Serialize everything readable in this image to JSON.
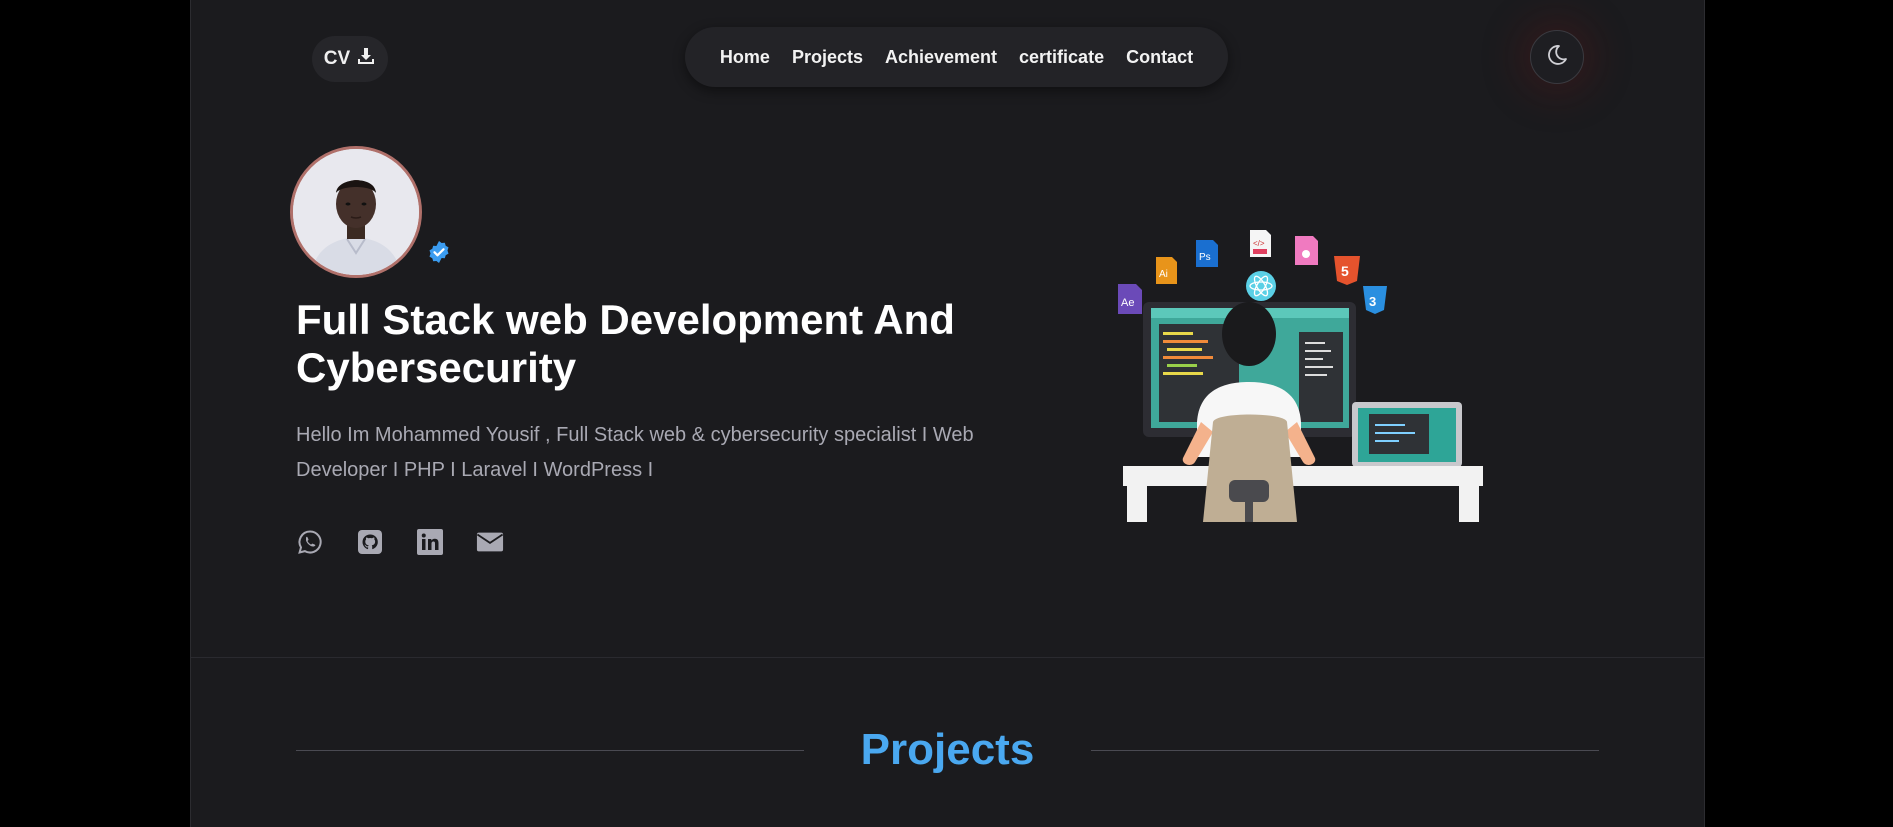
{
  "header": {
    "cv_label": "CV",
    "nav": [
      {
        "label": "Home"
      },
      {
        "label": "Projects"
      },
      {
        "label": "Achievement"
      },
      {
        "label": "certificate"
      },
      {
        "label": "Contact"
      }
    ],
    "theme_icon": "moon-icon"
  },
  "hero": {
    "title": "Full Stack web Development And Cybersecurity",
    "description": "Hello Im Mohammed Yousif , Full Stack web & cybersecurity specialist I Web Developer I PHP I Laravel I WordPress I",
    "verified_icon": "verified-badge-icon",
    "socials": [
      "whatsapp-icon",
      "github-icon",
      "linkedin-icon",
      "email-icon"
    ]
  },
  "projects_section": {
    "title": "Projects"
  },
  "colors": {
    "background": "#1b1b1e",
    "accent": "#4aa8f0",
    "text": "#ffffff",
    "muted": "#a9a9b3"
  }
}
